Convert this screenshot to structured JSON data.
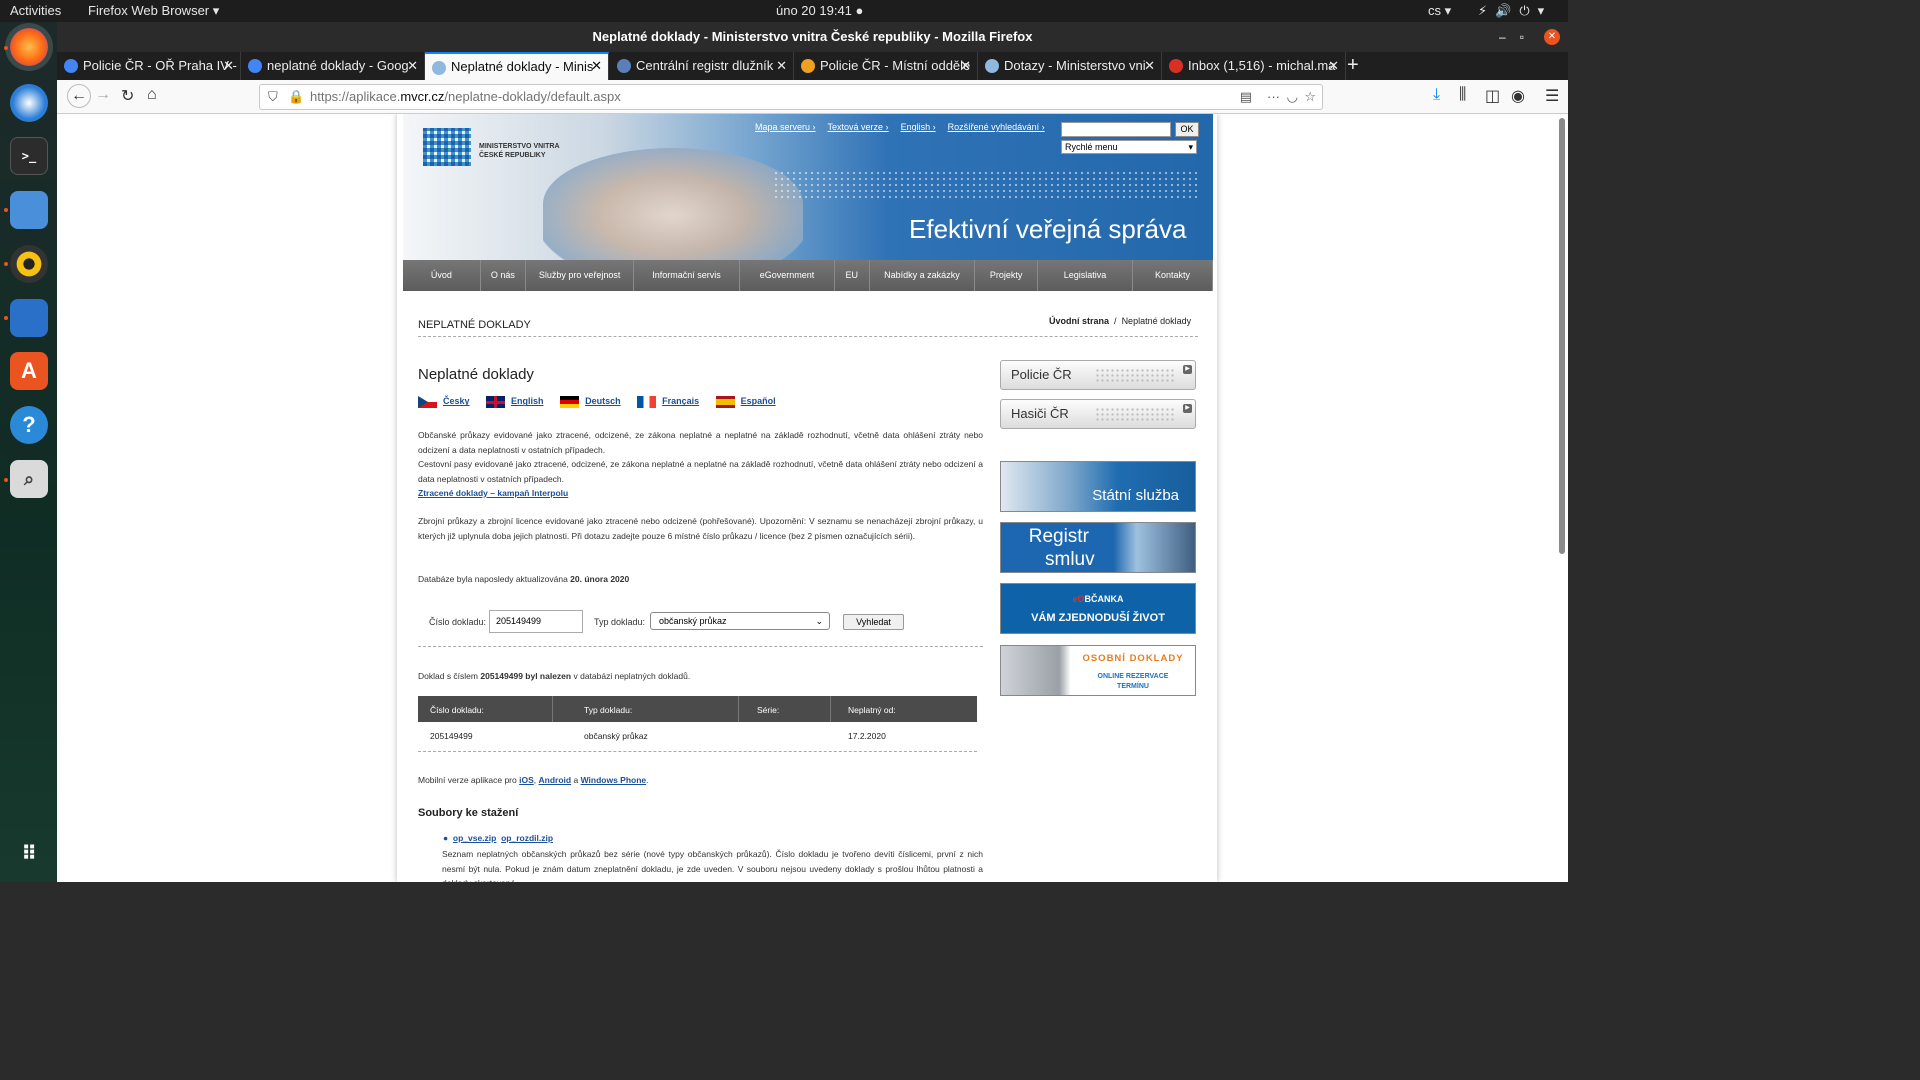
{
  "topbar": {
    "activities": "Activities",
    "app": "Firefox Web Browser ▾",
    "clock": "úno 20  19:41 ●",
    "lang": "cs ▾",
    "sys": "⚡🔊⏻▾"
  },
  "window": {
    "title": "Neplatné doklady - Ministerstvo vnitra České republiky - Mozilla Firefox"
  },
  "tabs": [
    {
      "label": "Policie ČR - OŘ Praha IV -",
      "color": "#4285f4"
    },
    {
      "label": "neplatné doklady - Goog",
      "color": "#4285f4"
    },
    {
      "label": "Neplatné doklady - Minis",
      "color": "#8fb8de"
    },
    {
      "label": "Centrální registr dlužník",
      "color": "#5b7fb8"
    },
    {
      "label": "Policie ČR - Místní odděle",
      "color": "#f0a020"
    },
    {
      "label": "Dotazy - Ministerstvo vni",
      "color": "#8fb8de"
    },
    {
      "label": "Inbox (1,516) - michal.ma",
      "color": "#d93025"
    }
  ],
  "url": {
    "prefix": "https://aplikace.",
    "domain": "mvcr.cz",
    "path": "/neplatne-doklady/default.aspx"
  },
  "site": {
    "logo_line1": "MINISTERSTVO VNITRA",
    "logo_line2": "ČESKÉ REPUBLIKY",
    "toplinks": [
      "Mapa serveru ›",
      "Textová verze ›",
      "English ›",
      "Rozšířené vyhledávání ›"
    ],
    "search_ok": "OK",
    "quick_menu": "Rychlé menu",
    "slogan": "Efektivní veřejná správa",
    "nav": [
      "Úvod",
      "O nás",
      "Služby pro veřejnost",
      "Informační servis",
      "eGovernment",
      "EU",
      "Nabídky a zakázky",
      "Projekty",
      "Legislativa",
      "Kontakty"
    ]
  },
  "page": {
    "section": "NEPLATNÉ DOKLADY",
    "crumb_home": "Úvodní strana",
    "crumb_sep": "/",
    "crumb_current": "Neplatné doklady",
    "heading": "Neplatné doklady",
    "langs": [
      "Česky",
      "English",
      "Deutsch",
      "Français",
      "Español"
    ],
    "p1": "Občanské průkazy evidované jako ztracené, odcizené, ze zákona neplatné a neplatné na základě rozhodnutí, včetně data ohlášení ztráty nebo odcizení a data neplatnosti v ostatních případech.",
    "p2": "Cestovní pasy evidované jako ztracené, odcizené, ze zákona neplatné a neplatné na základě rozhodnutí, včetně data ohlášení ztráty nebo odcizení a data neplatnosti v ostatních případech.",
    "interpol": "Ztracené doklady – kampaň Interpolu",
    "p3": "Zbrojní průkazy a zbrojní licence evidované jako ztracené nebo odcizené (pohřešované). Upozornění: V seznamu se nenacházejí zbrojní průkazy, u kterých již uplynula doba jejich platnosti. Při dotazu zadejte pouze 6 místné číslo průkazu / licence (bez 2 písmen označujících sérii).",
    "db_updated_label": "Databáze byla naposledy aktualizována",
    "db_updated_date": "20. února 2020",
    "form": {
      "num_label": "Číslo dokladu:",
      "num_value": "205149499",
      "type_label": "Typ dokladu:",
      "type_value": "občanský průkaz",
      "search_btn": "Vyhledat"
    },
    "found_prefix": "Doklad s číslem",
    "found_num": "205149499 byl nalezen",
    "found_suffix": "v databázi neplatných dokladů.",
    "table": {
      "headers": [
        "Číslo dokladu:",
        "Typ dokladu:",
        "Série:",
        "Neplatný od:"
      ],
      "row": [
        "205149499",
        "občanský průkaz",
        "",
        "17.2.2020"
      ]
    },
    "mobile_prefix": "Mobilní verze aplikace pro",
    "mobile_ios": "iOS",
    "mobile_android": "Android",
    "mobile_and": "a",
    "mobile_wp": "Windows Phone",
    "downloads_title": "Soubory ke stažení",
    "file1": "op_vse.zip",
    "file2": "op_rozdil.zip",
    "files_desc": "Seznam neplatných občanských průkazů bez série (nové typy občanských průkazů). Číslo dokladu je tvořeno devíti číslicemi, první z nich nesmí být nula. Pokud je znám datum zneplatnění dokladu, je zde uveden. V souboru nejsou uvedeny doklady s prošlou lhůtou platnosti a doklady skartované."
  },
  "side": {
    "police": "Policie ČR",
    "firefighters": "Hasiči ČR",
    "statni": "Státní služba",
    "registr1": "Registr",
    "registr2": "smluv",
    "eob_prefix": "eO",
    "eob_rest": "BČANKA",
    "eob_sub": "VÁM ZJEDNODUŠÍ ŽIVOT",
    "osobni1": "OSOBNÍ DOKLADY",
    "osobni2": "ONLINE REZERVACE",
    "osobni3": "TERMÍNU"
  }
}
